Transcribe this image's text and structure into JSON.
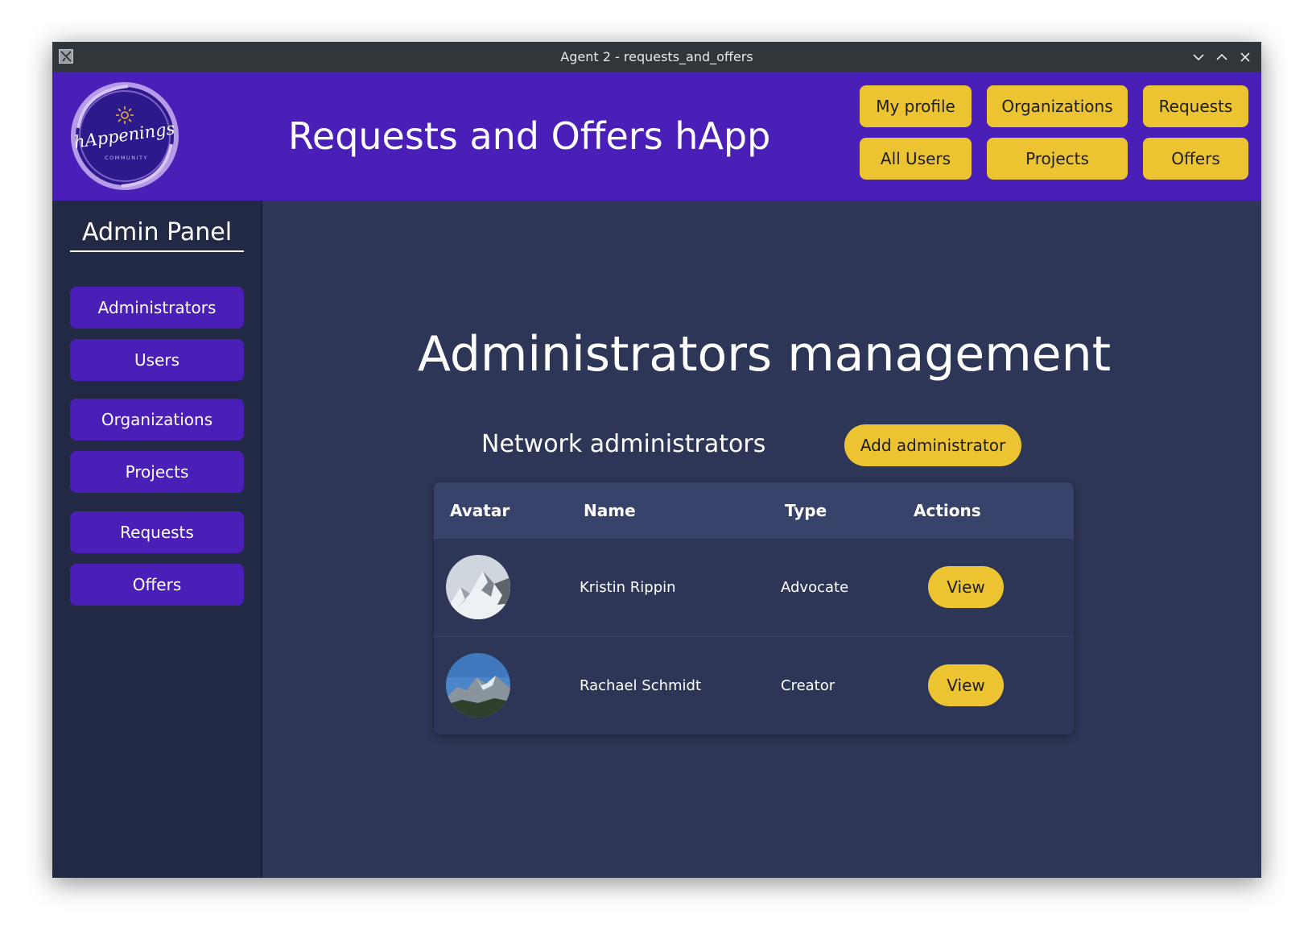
{
  "window": {
    "title": "Agent 2 - requests_and_offers"
  },
  "header": {
    "app_title": "Requests and Offers hApp",
    "logo_text": "hAppenings",
    "logo_subtext": "COMMUNITY",
    "nav": {
      "my_profile": "My profile",
      "organizations": "Organizations",
      "requests": "Requests",
      "all_users": "All Users",
      "projects": "Projects",
      "offers": "Offers"
    }
  },
  "sidebar": {
    "title": "Admin Panel",
    "items": [
      "Administrators",
      "Users",
      "Organizations",
      "Projects",
      "Requests",
      "Offers"
    ]
  },
  "main": {
    "title": "Administrators management",
    "section_title": "Network administrators",
    "add_button": "Add administrator",
    "table": {
      "columns": [
        "Avatar",
        "Name",
        "Type",
        "Actions"
      ],
      "rows": [
        {
          "name": "Kristin Rippin",
          "type": "Advocate",
          "action": "View"
        },
        {
          "name": "Rachael Schmidt",
          "type": "Creator",
          "action": "View"
        }
      ]
    }
  },
  "colors": {
    "header_bg": "#4a1fb8",
    "accent_yellow": "#ecc431",
    "main_bg": "#2d3656",
    "sidebar_bg": "#222944",
    "table_header_bg": "#37436b",
    "titlebar_bg": "#31363b"
  }
}
